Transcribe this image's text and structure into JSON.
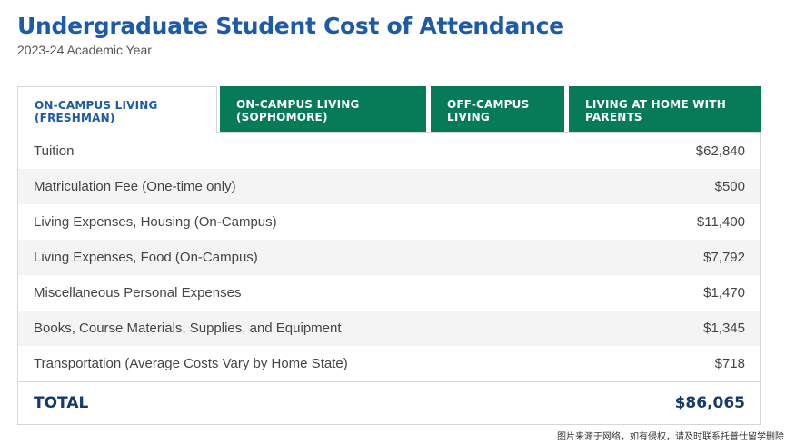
{
  "header": {
    "title": "Undergraduate Student Cost of Attendance",
    "subtitle": "2023-24 Academic Year"
  },
  "tabs": [
    {
      "label": "ON-CAMPUS LIVING (FRESHMAN)",
      "active": true
    },
    {
      "label": "ON-CAMPUS LIVING (SOPHOMORE)",
      "active": false
    },
    {
      "label": "OFF-CAMPUS LIVING",
      "active": false
    },
    {
      "label": "LIVING AT HOME WITH PARENTS",
      "active": false
    }
  ],
  "rows": [
    {
      "label": "Tuition",
      "amount": "$62,840"
    },
    {
      "label": "Matriculation Fee (One-time only)",
      "amount": "$500"
    },
    {
      "label": "Living Expenses, Housing (On-Campus)",
      "amount": "$11,400"
    },
    {
      "label": "Living Expenses, Food (On-Campus)",
      "amount": "$7,792"
    },
    {
      "label": "Miscellaneous Personal Expenses",
      "amount": "$1,470"
    },
    {
      "label": "Books, Course Materials, Supplies, and Equipment",
      "amount": "$1,345"
    },
    {
      "label": "Transportation (Average Costs Vary by Home State)",
      "amount": "$718"
    }
  ],
  "total": {
    "label": "TOTAL",
    "amount": "$86,065"
  },
  "watermark": "图片来源于网络，如有侵权，请及时联系托普仕留学删除",
  "colors": {
    "brand_blue": "#1d5aa9",
    "tab_green": "#077a58",
    "total_navy": "#163a6e",
    "stripe": "#f4f4f4"
  }
}
